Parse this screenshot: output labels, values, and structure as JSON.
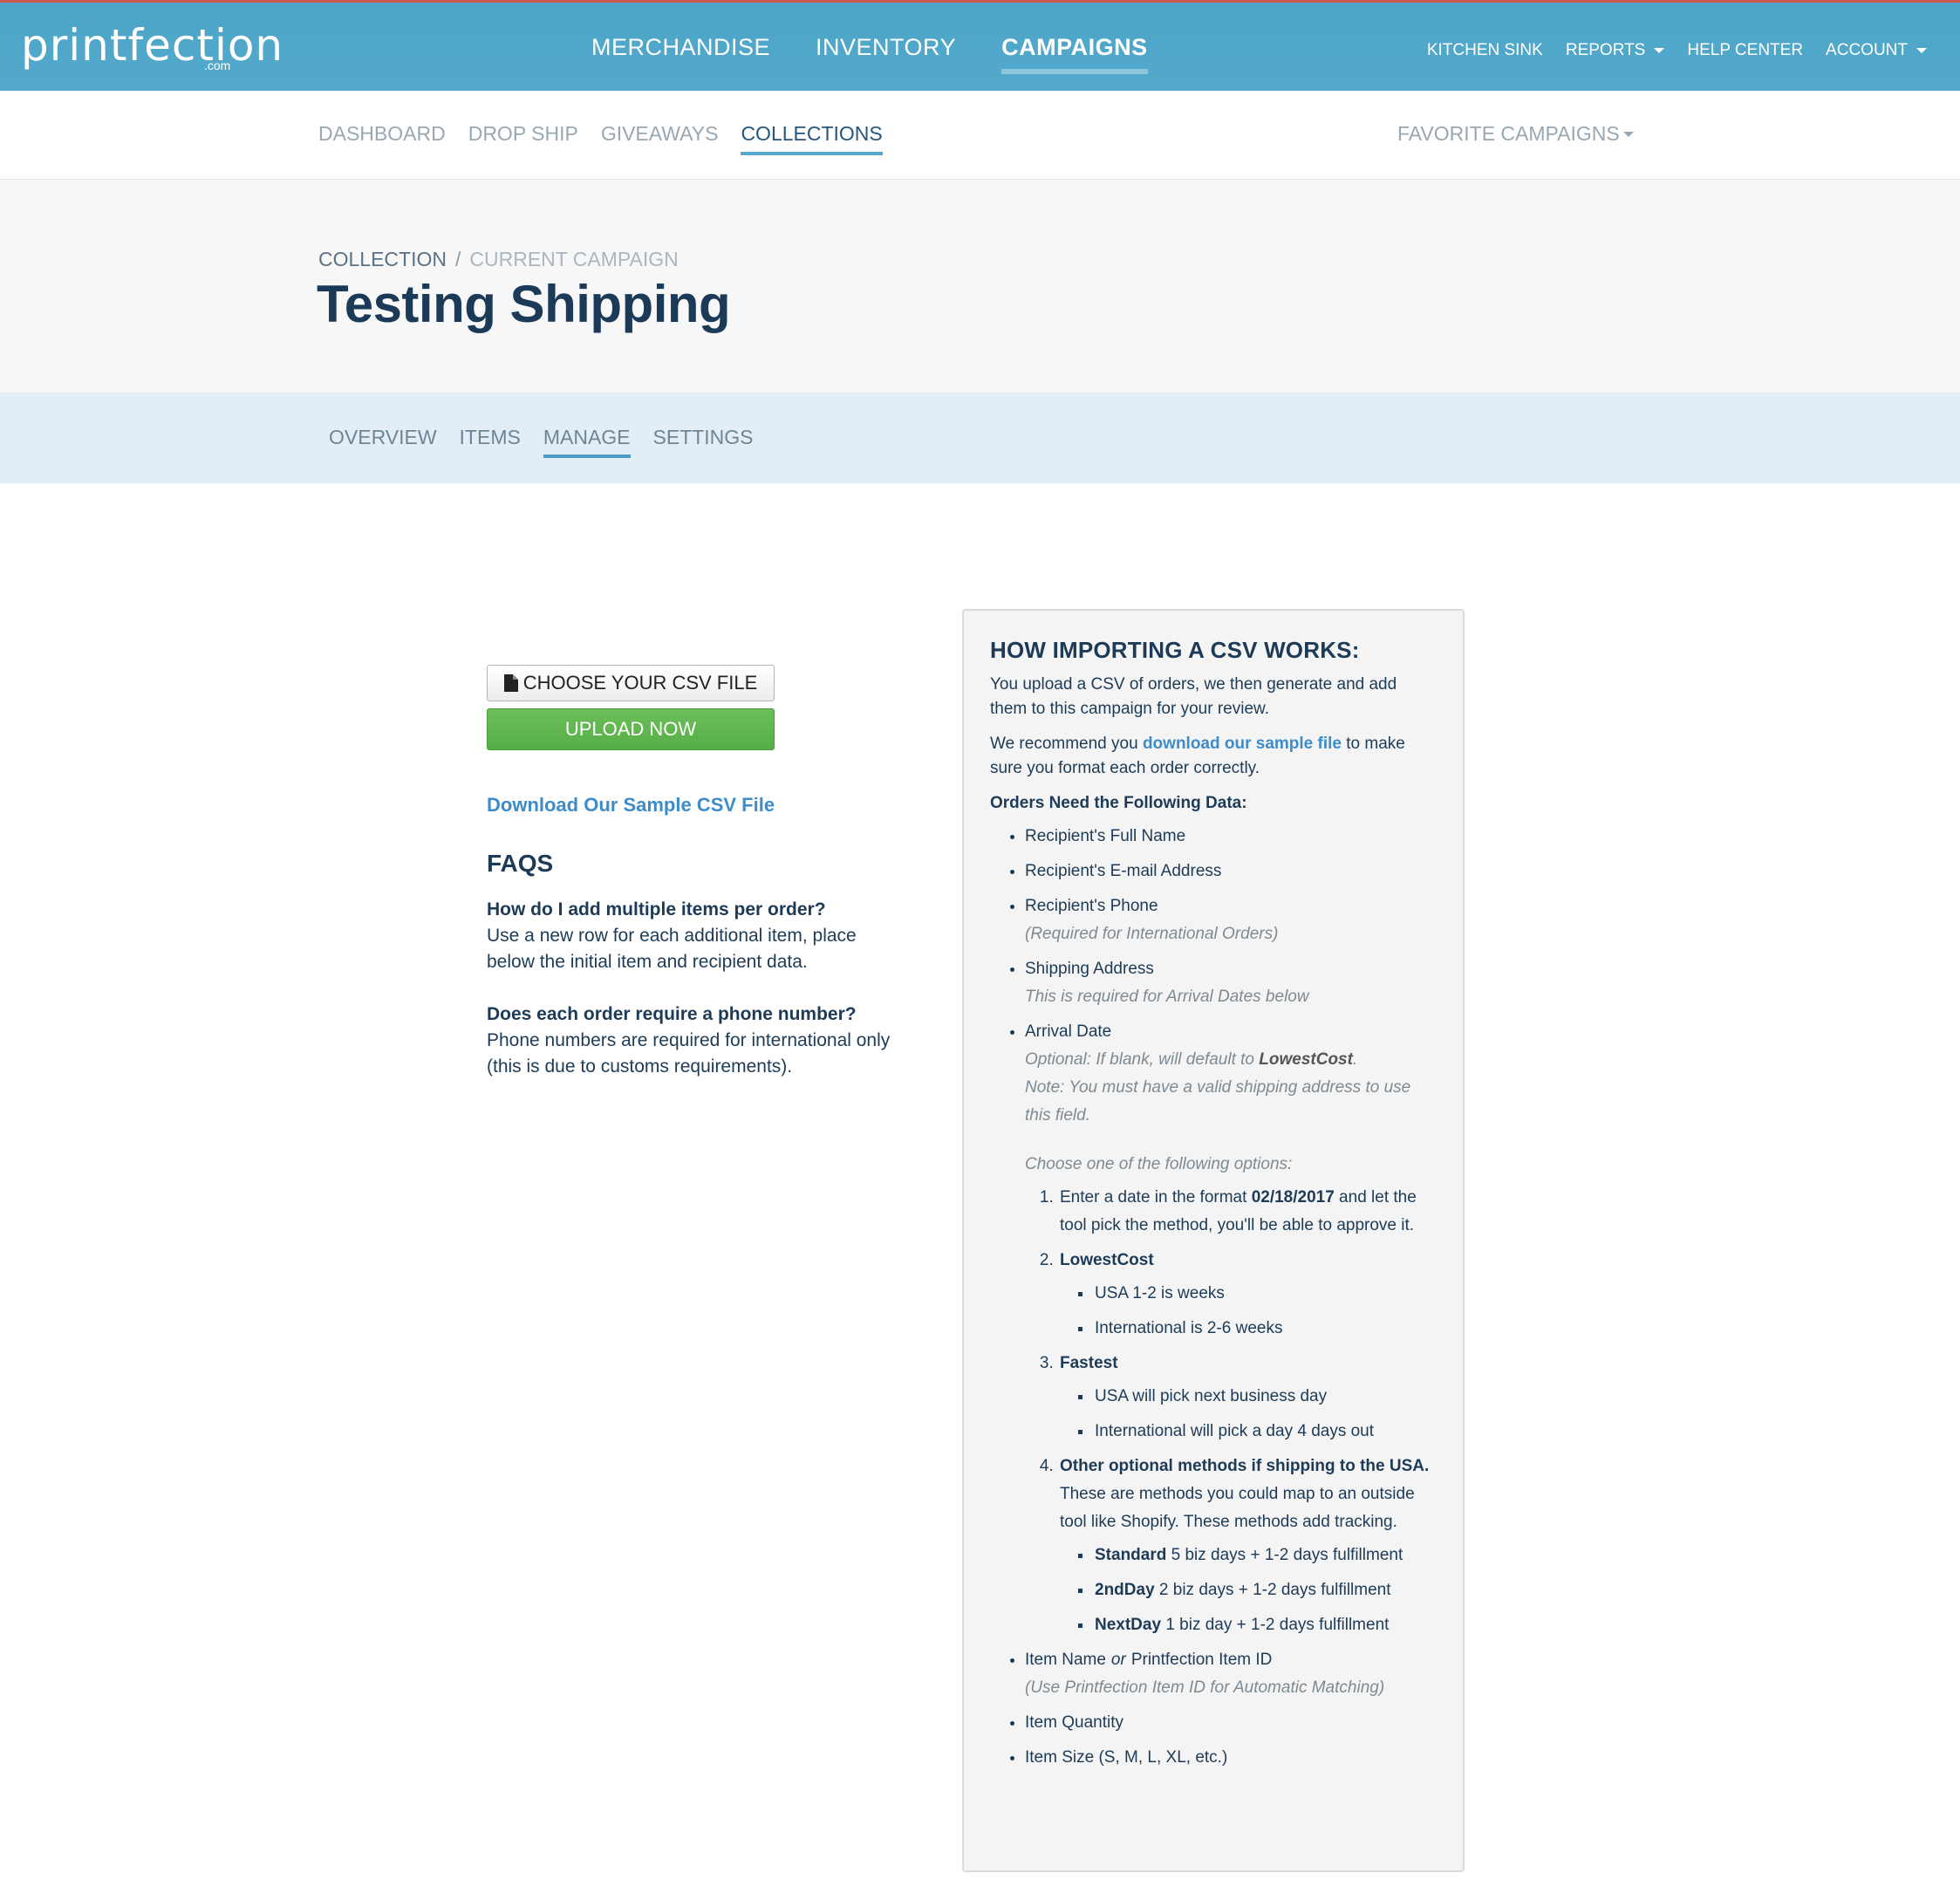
{
  "topbar": {
    "logo_text": "printfection",
    "logo_suffix": ".com",
    "main_nav": [
      "MERCHANDISE",
      "INVENTORY",
      "CAMPAIGNS"
    ],
    "util_nav": {
      "kitchen_sink": "KITCHEN SINK",
      "reports": "REPORTS",
      "help_center": "HELP CENTER",
      "account": "ACCOUNT"
    }
  },
  "subnav": {
    "links": [
      "DASHBOARD",
      "DROP SHIP",
      "GIVEAWAYS",
      "COLLECTIONS"
    ],
    "favorite": "FAVORITE CAMPAIGNS"
  },
  "header": {
    "breadcrumb": [
      "COLLECTION",
      "/",
      "CURRENT CAMPAIGN"
    ],
    "title": "Testing Shipping"
  },
  "tabs": [
    "OVERVIEW",
    "ITEMS",
    "MANAGE",
    "SETTINGS"
  ],
  "left": {
    "choose_label": "CHOOSE YOUR CSV FILE",
    "upload_label": "UPLOAD NOW",
    "download_link": "Download Our Sample CSV File",
    "faqs_title": "FAQS",
    "faqs": [
      {
        "q": "How do I add multiple items per order?",
        "a": "Use a new row for each additional item, place below the initial item and recipient data."
      },
      {
        "q": "Does each order require a phone number?",
        "a": "Phone numbers are required for international only (this is due to customs requirements)."
      }
    ]
  },
  "panel": {
    "title": "HOW IMPORTING A CSV WORKS:",
    "intro": "You upload a CSV of orders, we then generate and add them to this campaign for your review.",
    "recommend_pre": "We recommend you ",
    "recommend_link": "download our sample file",
    "recommend_post": " to make sure you format each order correctly.",
    "orders_need": "Orders Need the Following Data:",
    "fields": {
      "full_name": "Recipient's Full Name",
      "email": "Recipient's E-mail Address",
      "phone": "Recipient's Phone",
      "phone_note": "(Required for International Orders)",
      "shipping": "Shipping Address",
      "shipping_note": "This is required for Arrival Dates below",
      "arrival": "Arrival Date",
      "arrival_note_pre": "Optional: If blank, will default to ",
      "arrival_note_bold": "LowestCost",
      "arrival_note_post": ".",
      "arrival_note2": "Note: You must have a valid shipping address to use this field.",
      "choose_one": "Choose one of the following options:",
      "opt1_pre": "Enter a date in the format ",
      "opt1_bold": "02/18/2017",
      "opt1_post": " and let the tool pick the method, you'll be able to approve it.",
      "opt2": "LowestCost",
      "opt2_items": [
        "USA 1-2 is weeks",
        "International is 2-6 weeks"
      ],
      "opt3": "Fastest",
      "opt3_items": [
        "USA will pick next business day",
        "International will pick a day 4 days out"
      ],
      "opt4_bold": "Other optional methods if shipping to the USA.",
      "opt4_text": "These are methods you could map to an outside tool like Shopify. These methods add tracking.",
      "opt4_items": [
        {
          "bold": "Standard",
          "text": " 5 biz days + 1-2 days fulfillment"
        },
        {
          "bold": "2ndDay",
          "text": " 2 biz days + 1-2 days fulfillment"
        },
        {
          "bold": "NextDay",
          "text": " 1 biz day + 1-2 days fulfillment"
        }
      ],
      "item_name": "Item Name",
      "or": "or",
      "item_id": "Printfection Item ID",
      "item_note": "(Use Printfection Item ID for Automatic Matching)",
      "item_qty": "Item Quantity",
      "item_size": "Item Size (S, M, L, XL, etc.)"
    }
  },
  "colors": {
    "topbar": "#4aa5c7",
    "accent_underline": "#56a8cf",
    "upload_green": "#5bb24a",
    "link_blue": "#3e8cc7",
    "title_navy": "#1b3a58"
  }
}
